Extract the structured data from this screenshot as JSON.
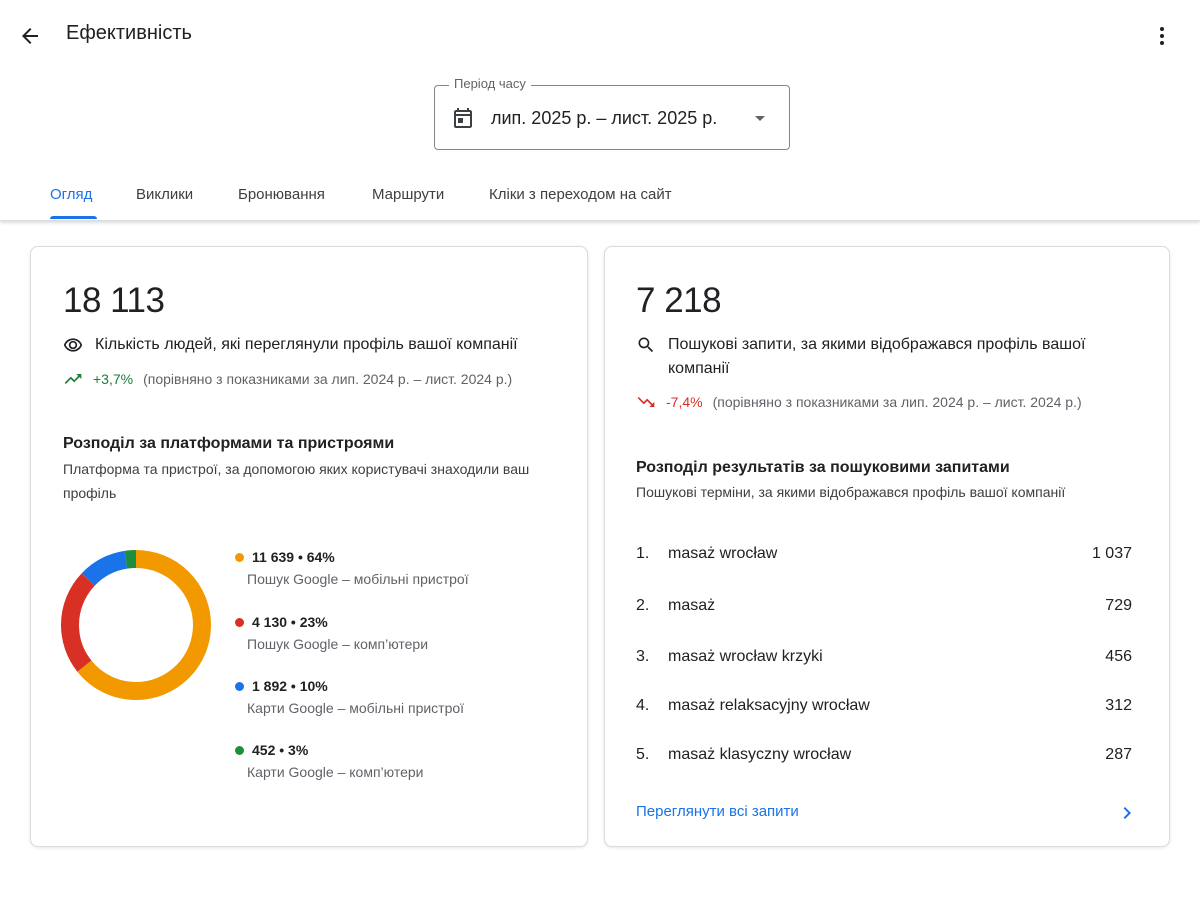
{
  "header": {
    "title": "Ефективність",
    "back_icon": "arrow-back-icon",
    "more_icon": "more-vert-icon"
  },
  "period": {
    "label": "Період часу",
    "value": "лип. 2025 р. – лист. 2025 р."
  },
  "tabs": [
    {
      "label": "Огляд",
      "active": true
    },
    {
      "label": "Виклики",
      "active": false
    },
    {
      "label": "Бронювання",
      "active": false
    },
    {
      "label": "Маршрути",
      "active": false
    },
    {
      "label": "Кліки з переходом на сайт",
      "active": false
    }
  ],
  "profile_views": {
    "total": "18 113",
    "label": "Кількість людей, які переглянули профіль вашої компанії",
    "delta": "+3,7%",
    "comparison": "(порівняно з показниками за лип. 2024 р. – лист. 2024 р.)",
    "breakdown_title": "Розподіл за платформами та пристроями",
    "breakdown_subtitle": "Платформа та пристрої, за допомогою яких користувачі знаходили ваш профіль"
  },
  "chart_data": {
    "type": "pie",
    "donut": true,
    "series": [
      {
        "name": "Пошук Google – мобільні пристрої",
        "value": 11639,
        "percent": 64,
        "display": "11 639 • 64%",
        "color": "#f29900"
      },
      {
        "name": "Пошук Google – комп’ютери",
        "value": 4130,
        "percent": 23,
        "display": "4 130 • 23%",
        "color": "#d93025"
      },
      {
        "name": "Карти Google – мобільні пристрої",
        "value": 1892,
        "percent": 10,
        "display": "1 892 • 10%",
        "color": "#1a73e8"
      },
      {
        "name": "Карти Google – комп’ютери",
        "value": 452,
        "percent": 3,
        "display": "452 • 3%",
        "color": "#1e8e3e"
      }
    ]
  },
  "searches": {
    "total": "7 218",
    "label": "Пошукові запити, за якими відображався профіль вашої компанії",
    "delta": "-7,4%",
    "comparison": "(порівняно з показниками за лип. 2024 р. – лист. 2024 р.)",
    "breakdown_title": "Розподіл результатів за пошуковими запитами",
    "breakdown_subtitle": "Пошукові терміни, за якими відображався профіль вашої компанії",
    "queries": [
      {
        "rank": "1.",
        "term": "masaż wrocław",
        "count": "1 037"
      },
      {
        "rank": "2.",
        "term": "masaż",
        "count": "729"
      },
      {
        "rank": "3.",
        "term": "masaż wrocław krzyki",
        "count": "456"
      },
      {
        "rank": "4.",
        "term": "masaż relaksacyjny wrocław",
        "count": "312"
      },
      {
        "rank": "5.",
        "term": "masaż klasyczny wrocław",
        "count": "287"
      }
    ],
    "view_all": "Переглянути всі запити"
  }
}
